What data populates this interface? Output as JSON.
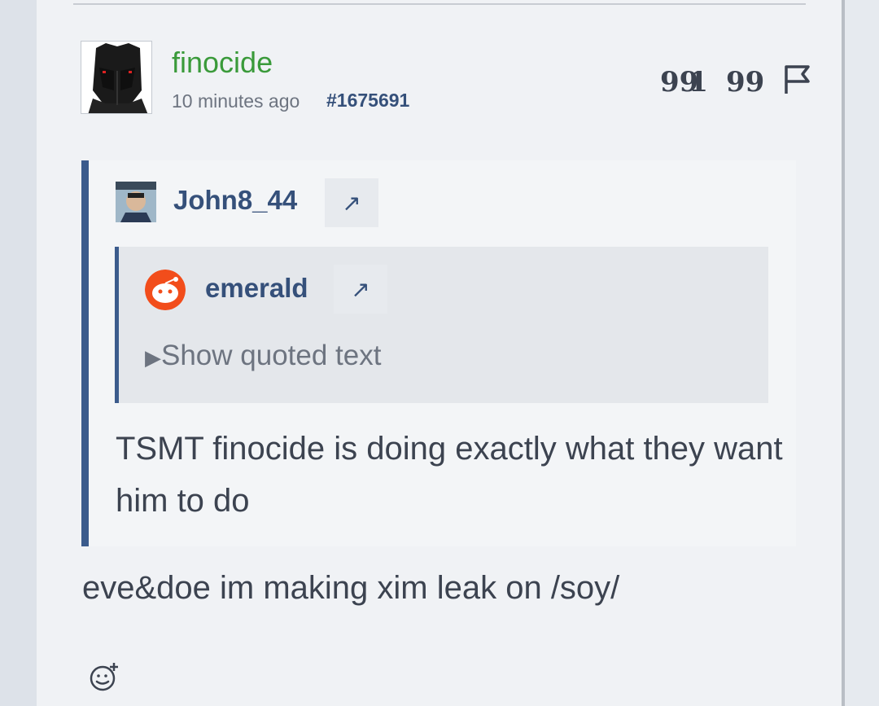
{
  "post": {
    "username": "finocide",
    "time": "10 minutes ago",
    "post_id": "#1675691",
    "actions": [
      "reply-quote-icon",
      "quote-icon",
      "report-flag-icon"
    ],
    "reply_count": "1",
    "text": "eve&doe im making xim leak on /soy/",
    "quote": {
      "author": "John8_44",
      "jump_icon": "↗",
      "nested": {
        "author": "emerald",
        "jump_icon": "↗",
        "toggle": "Show quoted text",
        "toggle_icon": "▶"
      },
      "text": "TSMT finocide is doing exactly what they want him to do"
    }
  },
  "colors": {
    "username": "#3a9a3a",
    "link": "#35507a",
    "quote_border": "#3b5b8c",
    "text": "#3c4350"
  }
}
